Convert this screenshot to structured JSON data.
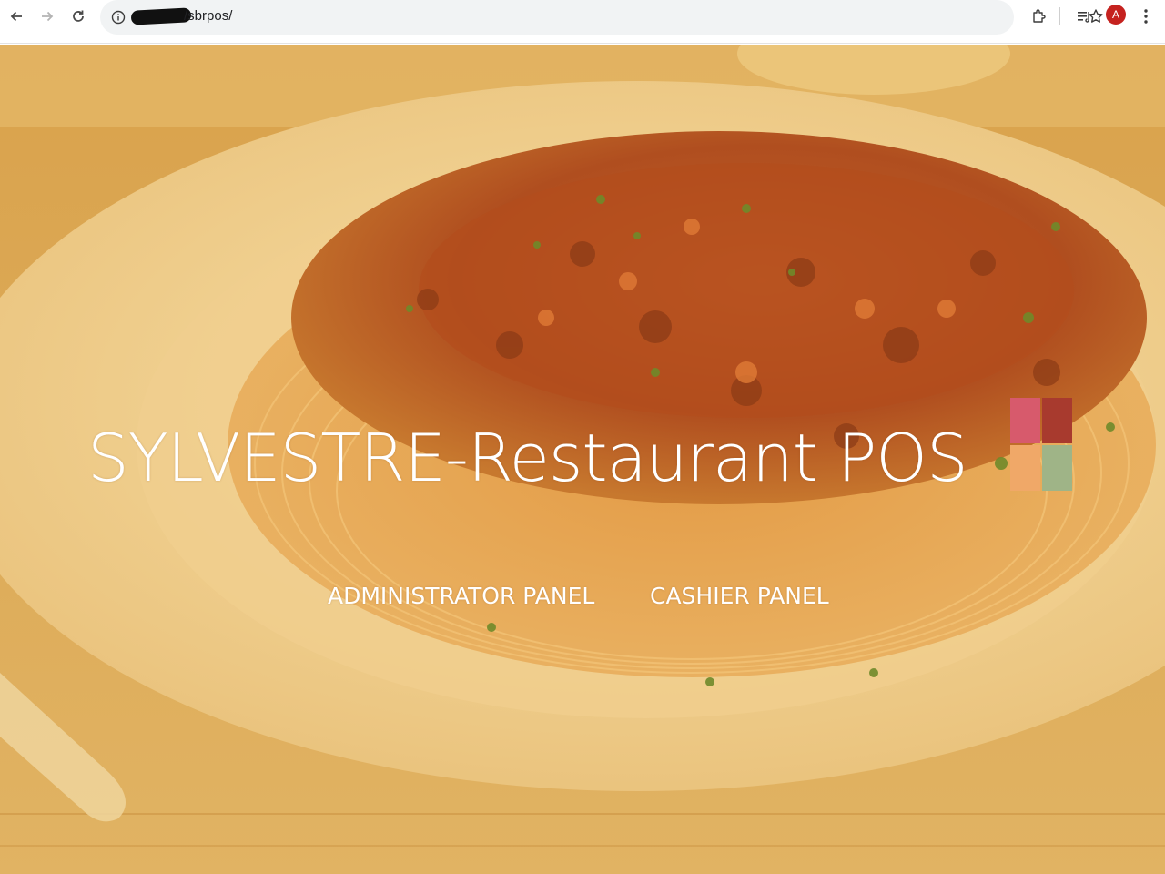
{
  "browser": {
    "url_visible_suffix": "/sbrpos/",
    "profile_initial": "A",
    "icons": {
      "back": "back-arrow-icon",
      "forward": "forward-arrow-icon",
      "reload": "reload-icon",
      "site_info": "info-icon",
      "bookmark": "star-icon",
      "extensions": "puzzle-icon",
      "reading_list": "reading-list-icon",
      "menu": "kebab-menu-icon"
    }
  },
  "page": {
    "title": "SYLVESTRE-Restaurant POS",
    "nav": {
      "admin_label": "ADMINISTRATOR PANEL",
      "cashier_label": "CASHIER PANEL"
    },
    "logo_colors": [
      "#d75a6c",
      "#a83a2e",
      "#f0a868",
      "#9fb487"
    ],
    "background_description_colors": {
      "overlay": "#e0a441",
      "sauce": "#b9541d"
    }
  }
}
